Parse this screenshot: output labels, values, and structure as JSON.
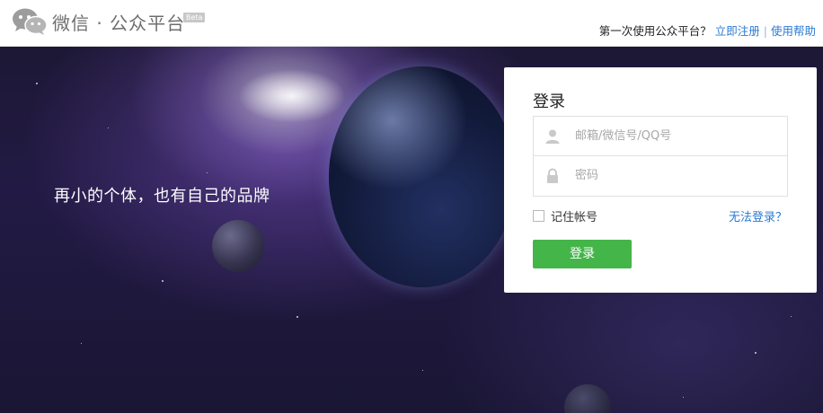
{
  "header": {
    "brand_title": "微信 · 公众平台",
    "beta_badge": "Beta",
    "first_time_text": "第一次使用公众平台？",
    "register_link": "立即注册",
    "separator": "|",
    "help_link": "使用帮助"
  },
  "hero": {
    "slogan": "再小的个体，也有自己的品牌"
  },
  "login": {
    "title": "登录",
    "username_placeholder": "邮箱/微信号/QQ号",
    "username_value": "",
    "password_placeholder": "密码",
    "password_value": "",
    "remember_label": "记住帐号",
    "remember_checked": false,
    "forgot_link": "无法登录？",
    "submit_label": "登录"
  },
  "icons": {
    "logo": "wechat-logo-icon",
    "user": "user-icon",
    "lock": "lock-icon"
  },
  "colors": {
    "accent_green": "#44b549",
    "link_blue": "#2a7ad2",
    "hero_dark": "#1d1836"
  }
}
